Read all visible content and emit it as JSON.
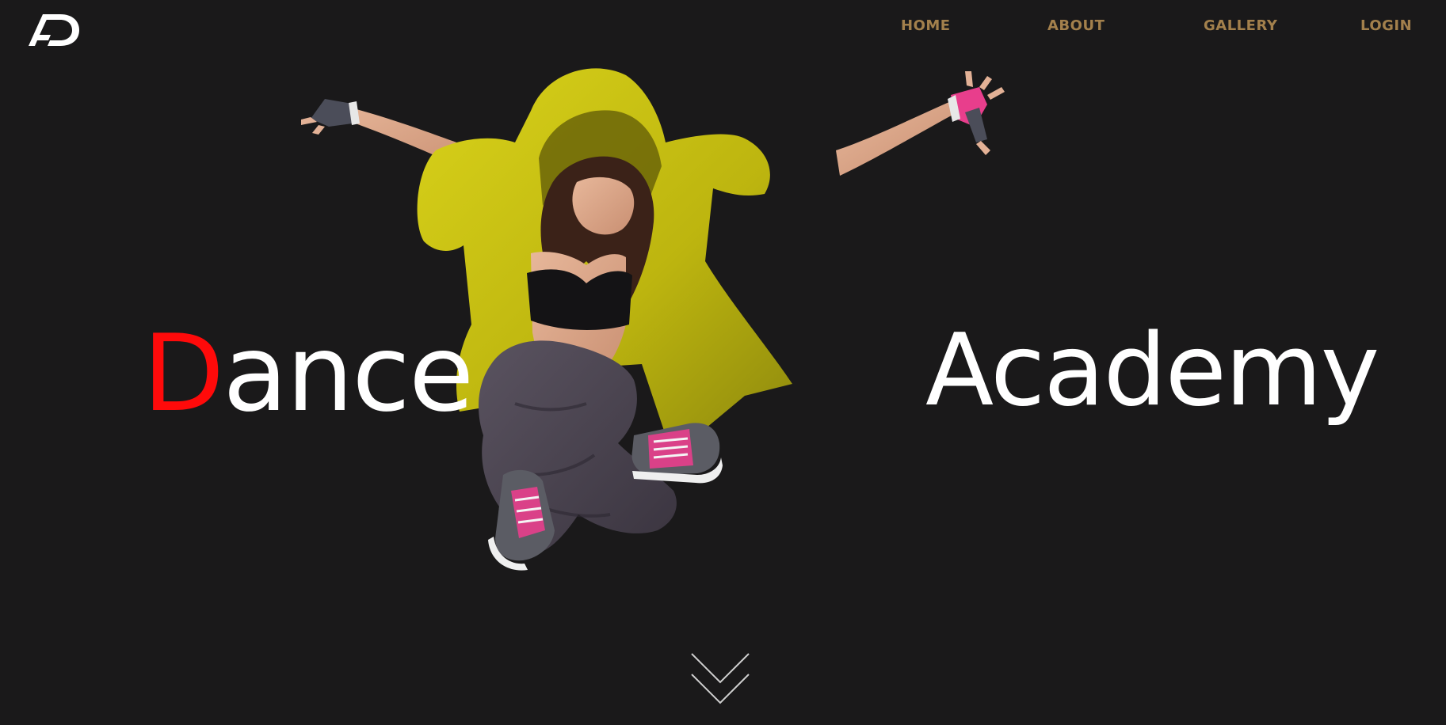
{
  "brand": {
    "logo_text": "AD",
    "logo_icon": "ad-monogram-logo"
  },
  "nav": {
    "items": [
      {
        "label": "HOME"
      },
      {
        "label": "ABOUT"
      },
      {
        "label": "GALLERY"
      },
      {
        "label": "LOGIN"
      }
    ],
    "color": "#a3804c"
  },
  "hero": {
    "word1_initial": "D",
    "word1_rest": "ance",
    "word2": "Academy",
    "accent_color": "#ff0a0a",
    "text_color": "#ffffff",
    "image": "dancer-in-yellow-hoodie-jumping"
  },
  "scroll": {
    "icon": "double-chevron-down-icon"
  },
  "colors": {
    "background": "#1a191a",
    "hoodie": "#c9c112",
    "pants": "#4a4450",
    "shoe_accent": "#e83e8c"
  }
}
